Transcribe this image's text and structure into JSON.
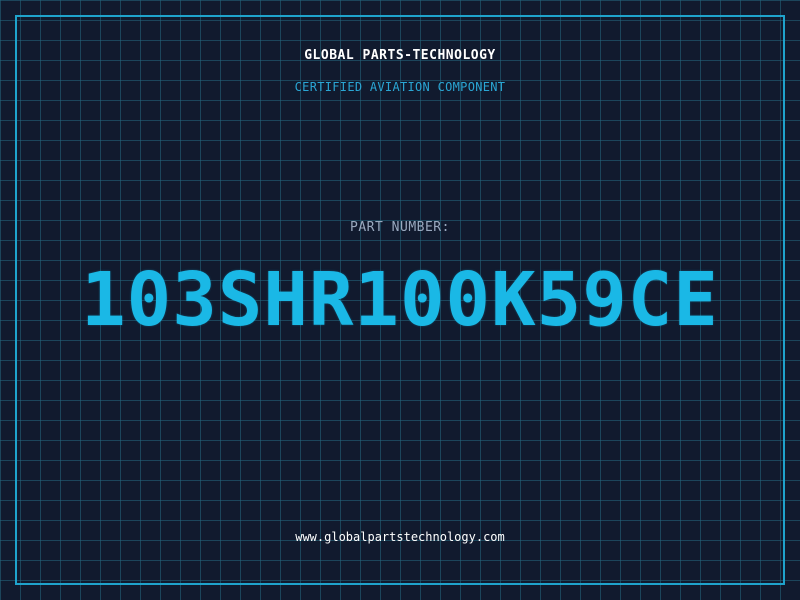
{
  "header": {
    "company": "GLOBAL PARTS-TECHNOLOGY",
    "subtitle": "CERTIFIED AVIATION COMPONENT"
  },
  "part": {
    "label": "PART NUMBER:",
    "number": "103SHR100K59CE"
  },
  "footer": {
    "website": "www.globalpartstechnology.com"
  },
  "colors": {
    "background": "#111a2e",
    "grid": "#246880",
    "frame": "#1fa3cc",
    "accent": "#1ab8e6",
    "label": "#9aa9bf",
    "text": "#ffffff"
  }
}
